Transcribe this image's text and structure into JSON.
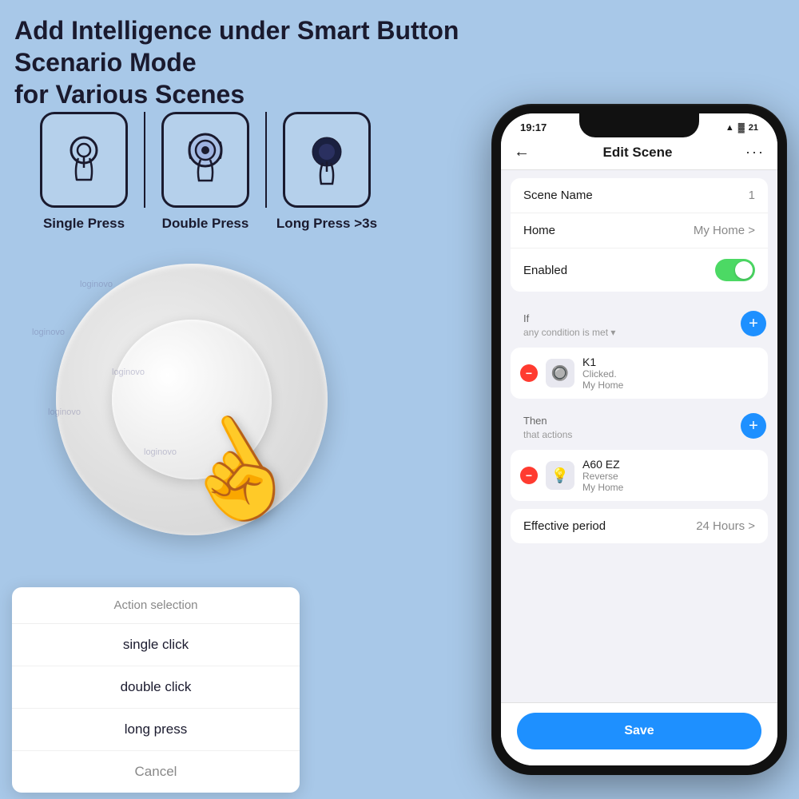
{
  "header": {
    "title": "Add Intelligence under Smart Button Scenario Mode\nfor Various Scenes"
  },
  "press_types": [
    {
      "id": "single",
      "label": "Single Press"
    },
    {
      "id": "double",
      "label": "Double Press"
    },
    {
      "id": "long",
      "label": "Long Press >3s"
    }
  ],
  "action_popup": {
    "header": "Action selection",
    "items": [
      "single click",
      "double click",
      "long press"
    ],
    "cancel": "Cancel"
  },
  "phone": {
    "status_bar": {
      "time": "19:17",
      "wifi": "WiFi",
      "battery": "21"
    },
    "app_header": {
      "back": "←",
      "title": "Edit Scene",
      "more": "···"
    },
    "scene_name_label": "Scene Name",
    "scene_name_value": "1",
    "home_label": "Home",
    "home_value": "My Home >",
    "enabled_label": "Enabled",
    "if_label": "If",
    "if_condition": "any condition is met",
    "then_label": "Then",
    "then_condition": "that actions",
    "device_k1": {
      "name": "K1",
      "detail1": "Clicked.",
      "detail2": "My Home"
    },
    "device_a60": {
      "name": "A60 EZ",
      "detail1": "Reverse",
      "detail2": "My Home"
    },
    "effective_label": "Effective period",
    "effective_value": "24 Hours >",
    "save_button": "Save"
  },
  "watermarks": [
    "loginovo",
    "loginovo loginovo"
  ]
}
